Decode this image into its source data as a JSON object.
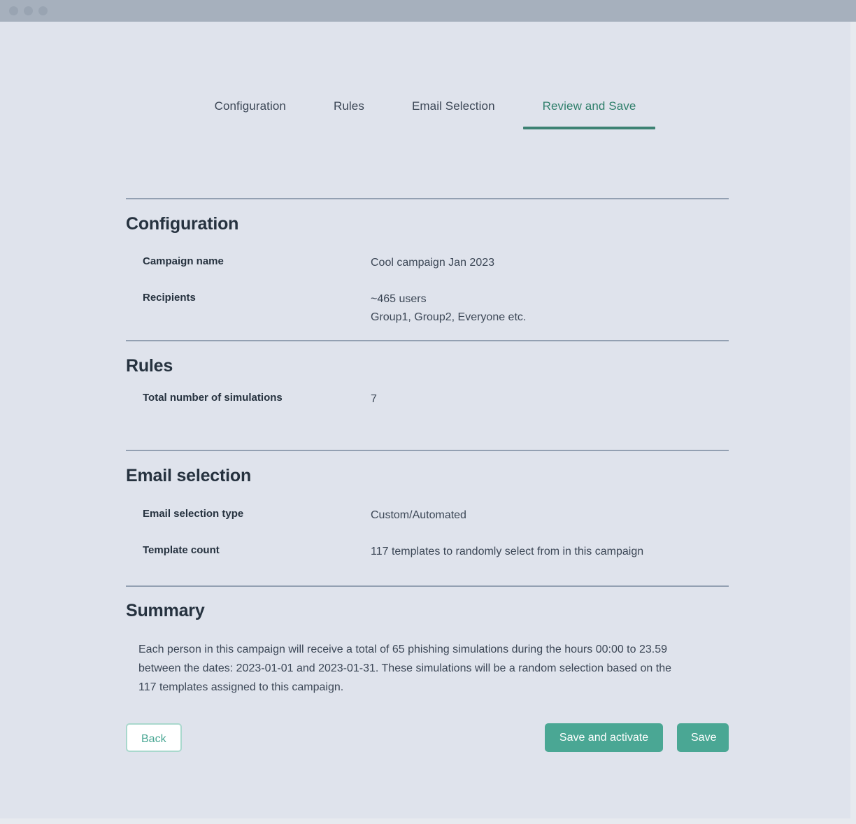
{
  "window": {
    "traffic_lights": [
      "close",
      "minimize",
      "zoom"
    ]
  },
  "tabs": [
    {
      "label": "Configuration",
      "active": false
    },
    {
      "label": "Rules",
      "active": false
    },
    {
      "label": "Email Selection",
      "active": false
    },
    {
      "label": "Review and Save",
      "active": true
    }
  ],
  "sections": {
    "configuration": {
      "heading": "Configuration",
      "rows": [
        {
          "label": "Campaign name",
          "lines": [
            "Cool campaign Jan 2023"
          ]
        },
        {
          "label": "Recipients",
          "lines": [
            "~465 users",
            "Group1, Group2, Everyone etc."
          ]
        }
      ]
    },
    "rules": {
      "heading": "Rules",
      "rows": [
        {
          "label": "Total number of simulations",
          "lines": [
            "7"
          ]
        }
      ]
    },
    "email_selection": {
      "heading": "Email selection",
      "rows": [
        {
          "label": "Email selection type",
          "lines": [
            "Custom/Automated"
          ]
        },
        {
          "label": "Template count",
          "lines": [
            "117 templates to randomly select from in this campaign"
          ]
        }
      ]
    },
    "summary": {
      "heading": "Summary",
      "body": "Each person in this campaign will receive a total of 65 phishing simulations during the hours 00:00 to 23.59 between the dates: 2023-01-01 and 2023-01-31. These simulations will be a random selection based on the 117 templates assigned to this campaign."
    }
  },
  "footer": {
    "back_label": "Back",
    "save_and_activate_label": "Save and activate",
    "save_label": "Save"
  },
  "colors": {
    "page_background": "#dfe3ec",
    "titlebar": "#a6b0bd",
    "accent_teal": "#4aa794",
    "active_tab": "#2f7f6b",
    "tab_underline": "#3d8273",
    "heading": "#26323f",
    "body_text": "#3c4756",
    "divider": "#93a0b2",
    "back_border": "#a9d8cd"
  }
}
